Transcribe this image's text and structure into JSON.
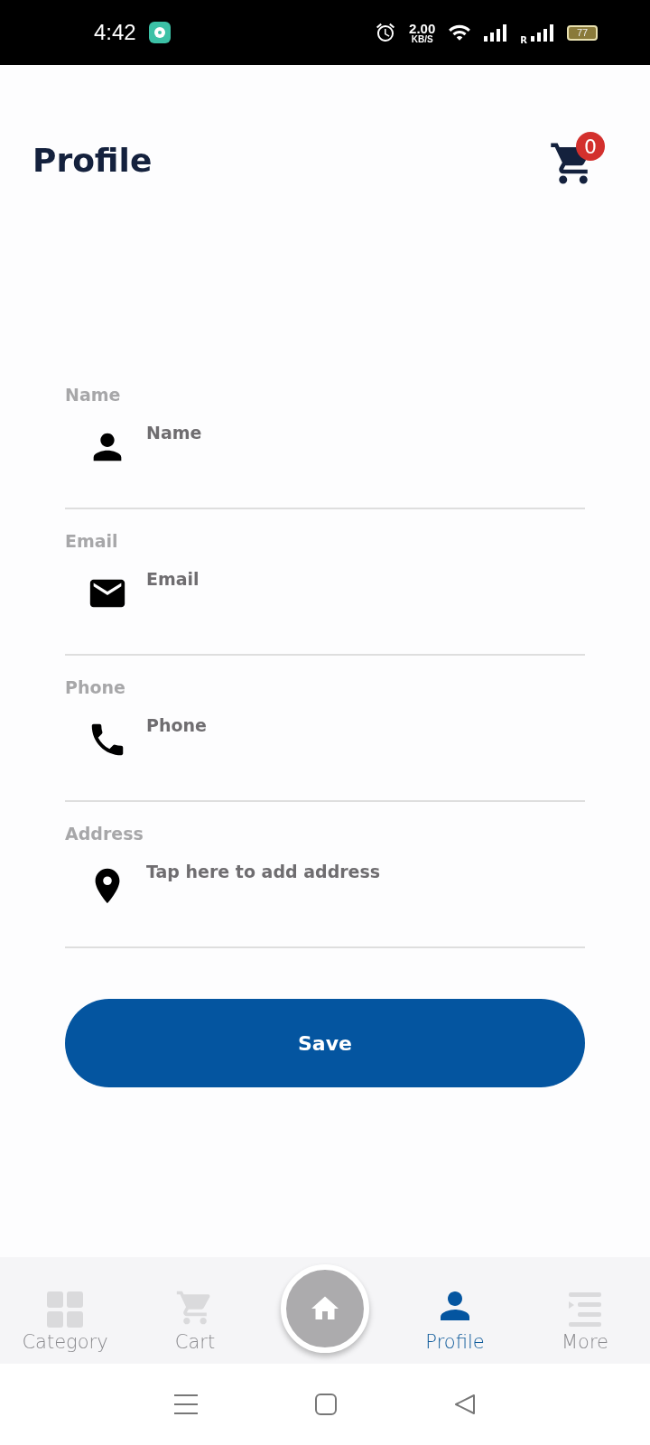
{
  "status_bar": {
    "time": "4:42",
    "speed_value": "2.00",
    "speed_unit": "KB/S",
    "sim_label": "R",
    "battery": "77"
  },
  "header": {
    "title": "Profile",
    "cart_count": "0"
  },
  "form": {
    "fields": [
      {
        "label": "Name",
        "placeholder": "Name",
        "kind": "person"
      },
      {
        "label": "Email",
        "placeholder": "Email",
        "kind": "email"
      },
      {
        "label": "Phone",
        "placeholder": "Phone",
        "kind": "phone"
      },
      {
        "label": "Address",
        "placeholder": "Tap here to add address",
        "kind": "location"
      }
    ],
    "submit": "Save"
  },
  "bottom_nav": {
    "items": [
      {
        "label": "Category",
        "kind": "grid",
        "selected": false
      },
      {
        "label": "Cart",
        "kind": "cart",
        "selected": false
      },
      {
        "kind": "home",
        "selected": false
      },
      {
        "label": "Profile",
        "kind": "person",
        "selected": true
      },
      {
        "label": "More",
        "kind": "more",
        "selected": false
      }
    ]
  }
}
